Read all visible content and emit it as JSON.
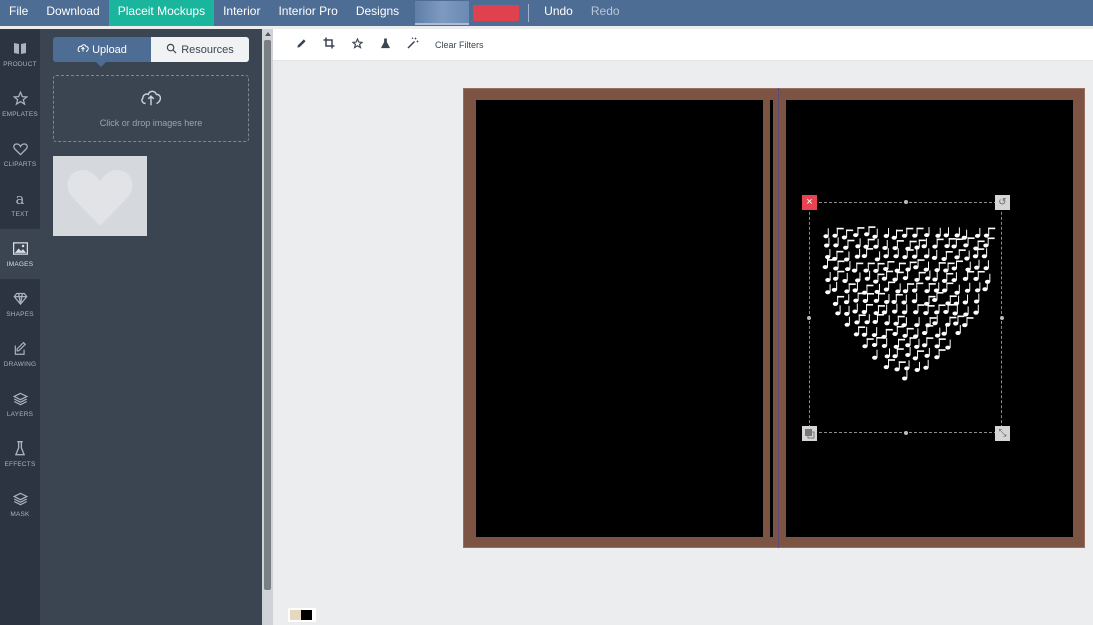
{
  "menu": {
    "items": [
      {
        "label": "File"
      },
      {
        "label": "Download"
      },
      {
        "label": "Placeit Mockups",
        "active": true
      },
      {
        "label": "Interior"
      },
      {
        "label": "Interior Pro"
      },
      {
        "label": "Designs"
      }
    ],
    "undo_label": "Undo",
    "redo_label": "Redo"
  },
  "rail": {
    "items": [
      {
        "label": "PRODUCT",
        "icon": "book-icon"
      },
      {
        "label": "EMPLATES",
        "icon": "star-icon"
      },
      {
        "label": "CLIPARTS",
        "icon": "heart-icon"
      },
      {
        "label": "TEXT",
        "icon": "text-a-icon"
      },
      {
        "label": "IMAGES",
        "icon": "image-icon",
        "active": true
      },
      {
        "label": "SHAPES",
        "icon": "diamond-icon"
      },
      {
        "label": "DRAWING",
        "icon": "pencil-square-icon"
      },
      {
        "label": "LAYERS",
        "icon": "layers-icon"
      },
      {
        "label": "EFFECTS",
        "icon": "flask-icon"
      },
      {
        "label": "MASK",
        "icon": "mask-icon"
      }
    ]
  },
  "panel": {
    "upload_tab": "Upload",
    "resources_tab": "Resources",
    "dropzone_text": "Click or drop images here"
  },
  "toolbar": {
    "tools": [
      "pencil-icon",
      "crop-icon",
      "star-icon",
      "flask-icon",
      "magic-wand-icon"
    ],
    "clear_filters": "Clear Filters"
  },
  "colors": {
    "menu_bg": "#4d6d94",
    "active_menu": "#1ab59d",
    "frame": "#7d5344",
    "delete_handle": "#e9434f"
  }
}
